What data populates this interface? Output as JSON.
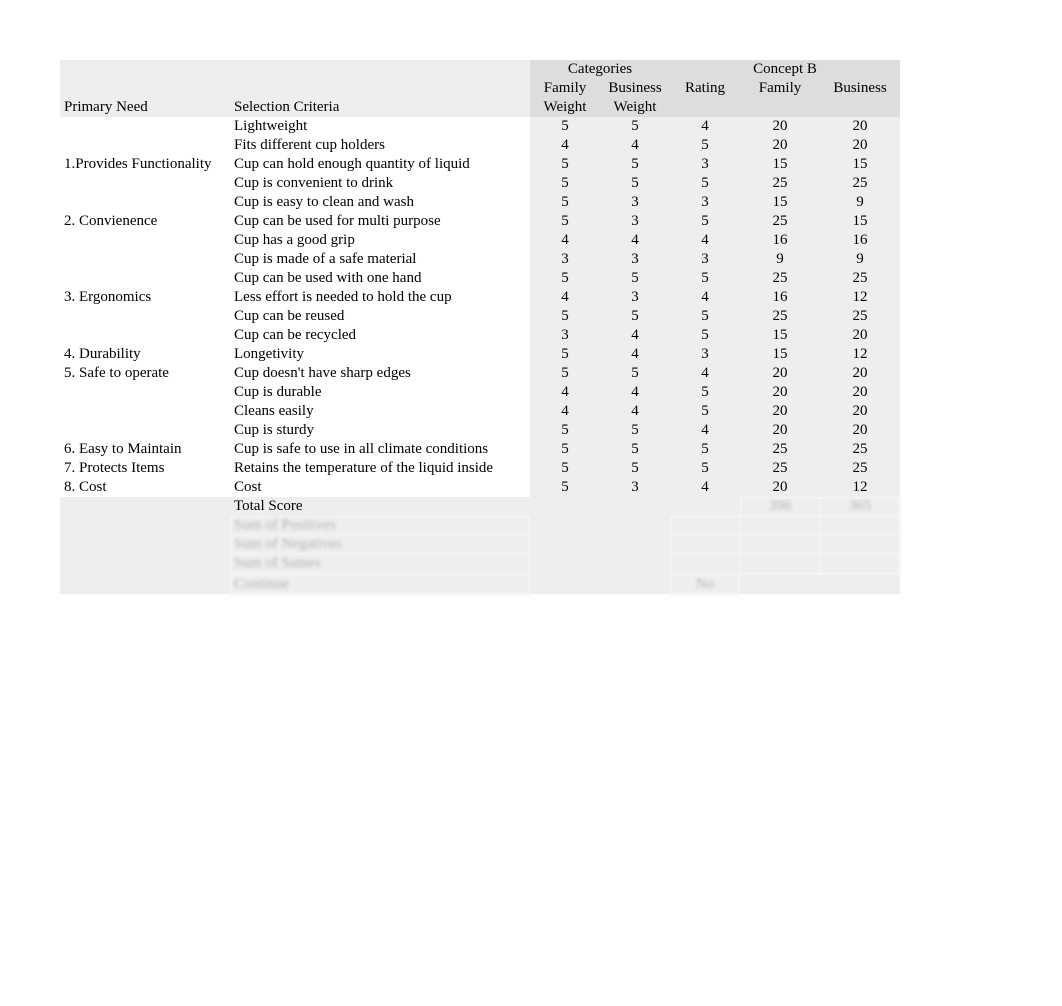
{
  "headers": {
    "categories_label": "Categories",
    "concept_label": "Concept B",
    "primary_need": "Primary Need",
    "selection_criteria": "Selection Criteria",
    "family_weight_1": "Family",
    "family_weight_2": "Weight",
    "business_weight_1": "Business",
    "business_weight_2": "Weight",
    "rating": "Rating",
    "family": "Family",
    "business": "Business"
  },
  "rows": [
    {
      "primary": "",
      "criteria": "Lightweight",
      "fw": "5",
      "bw": "5",
      "r": "4",
      "fam": "20",
      "bus": "20"
    },
    {
      "primary": "",
      "criteria": "Fits different cup holders",
      "fw": "4",
      "bw": "4",
      "r": "5",
      "fam": "20",
      "bus": "20"
    },
    {
      "primary": "1.Provides Functionality",
      "criteria": "Cup can hold enough quantity of liquid",
      "fw": "5",
      "bw": "5",
      "r": "3",
      "fam": "15",
      "bus": "15"
    },
    {
      "primary": "",
      "criteria": "Cup is convenient to drink",
      "fw": "5",
      "bw": "5",
      "r": "5",
      "fam": "25",
      "bus": "25"
    },
    {
      "primary": "",
      "criteria": "Cup is easy to clean and wash",
      "fw": "5",
      "bw": "3",
      "r": "3",
      "fam": "15",
      "bus": "9"
    },
    {
      "primary": "2. Convienence",
      "criteria": "Cup can be used for multi purpose",
      "fw": "5",
      "bw": "3",
      "r": "5",
      "fam": "25",
      "bus": "15"
    },
    {
      "primary": "",
      "criteria": "Cup has a good grip",
      "fw": "4",
      "bw": "4",
      "r": "4",
      "fam": "16",
      "bus": "16"
    },
    {
      "primary": "",
      "criteria": "Cup is made of a safe material",
      "fw": "3",
      "bw": "3",
      "r": "3",
      "fam": "9",
      "bus": "9"
    },
    {
      "primary": "",
      "criteria": "Cup can be used with one hand",
      "fw": "5",
      "bw": "5",
      "r": "5",
      "fam": "25",
      "bus": "25"
    },
    {
      "primary": "3. Ergonomics",
      "criteria": "Less effort is needed to hold the cup",
      "fw": "4",
      "bw": "3",
      "r": "4",
      "fam": "16",
      "bus": "12"
    },
    {
      "primary": "",
      "criteria": "Cup can be reused",
      "fw": "5",
      "bw": "5",
      "r": "5",
      "fam": "25",
      "bus": "25"
    },
    {
      "primary": "",
      "criteria": "Cup can be recycled",
      "fw": "3",
      "bw": "4",
      "r": "5",
      "fam": "15",
      "bus": "20"
    },
    {
      "primary": "4. Durability",
      "criteria": "Longetivity",
      "fw": "5",
      "bw": "4",
      "r": "3",
      "fam": "15",
      "bus": "12"
    },
    {
      "primary": "5. Safe to operate",
      "criteria": "Cup doesn't have sharp edges",
      "fw": "5",
      "bw": "5",
      "r": "4",
      "fam": "20",
      "bus": "20"
    },
    {
      "primary": "",
      "criteria": "Cup is durable",
      "fw": "4",
      "bw": "4",
      "r": "5",
      "fam": "20",
      "bus": "20"
    },
    {
      "primary": "",
      "criteria": "Cleans easily",
      "fw": "4",
      "bw": "4",
      "r": "5",
      "fam": "20",
      "bus": "20"
    },
    {
      "primary": "",
      "criteria": "Cup is sturdy",
      "fw": "5",
      "bw": "5",
      "r": "4",
      "fam": "20",
      "bus": "20"
    },
    {
      "primary": "6. Easy to Maintain",
      "criteria": "Cup is safe to use in all climate conditions",
      "fw": "5",
      "bw": "5",
      "r": "5",
      "fam": "25",
      "bus": "25"
    },
    {
      "primary": "7. Protects Items",
      "criteria": "Retains the temperature of the liquid inside",
      "fw": "5",
      "bw": "5",
      "r": "5",
      "fam": "25",
      "bus": "25"
    },
    {
      "primary": "8. Cost",
      "criteria": "Cost",
      "fw": "5",
      "bw": "3",
      "r": "4",
      "fam": "20",
      "bus": "12"
    }
  ],
  "totals": {
    "total_score_label": "Total Score",
    "total_family": "396",
    "total_business": "365"
  },
  "footer": {
    "row1": {
      "crit": "Sum of Positives",
      "r": "",
      "fam": "",
      "bus": ""
    },
    "row2": {
      "crit": "Sum of Negatives",
      "r": "",
      "fam": "",
      "bus": ""
    },
    "row3": {
      "crit": "Sum of Sames",
      "r": "",
      "fam": "",
      "bus": ""
    },
    "row4": {
      "crit": "",
      "r": "",
      "fam": "",
      "bus": ""
    },
    "continue_label": "Continue",
    "continue_value": "No"
  }
}
